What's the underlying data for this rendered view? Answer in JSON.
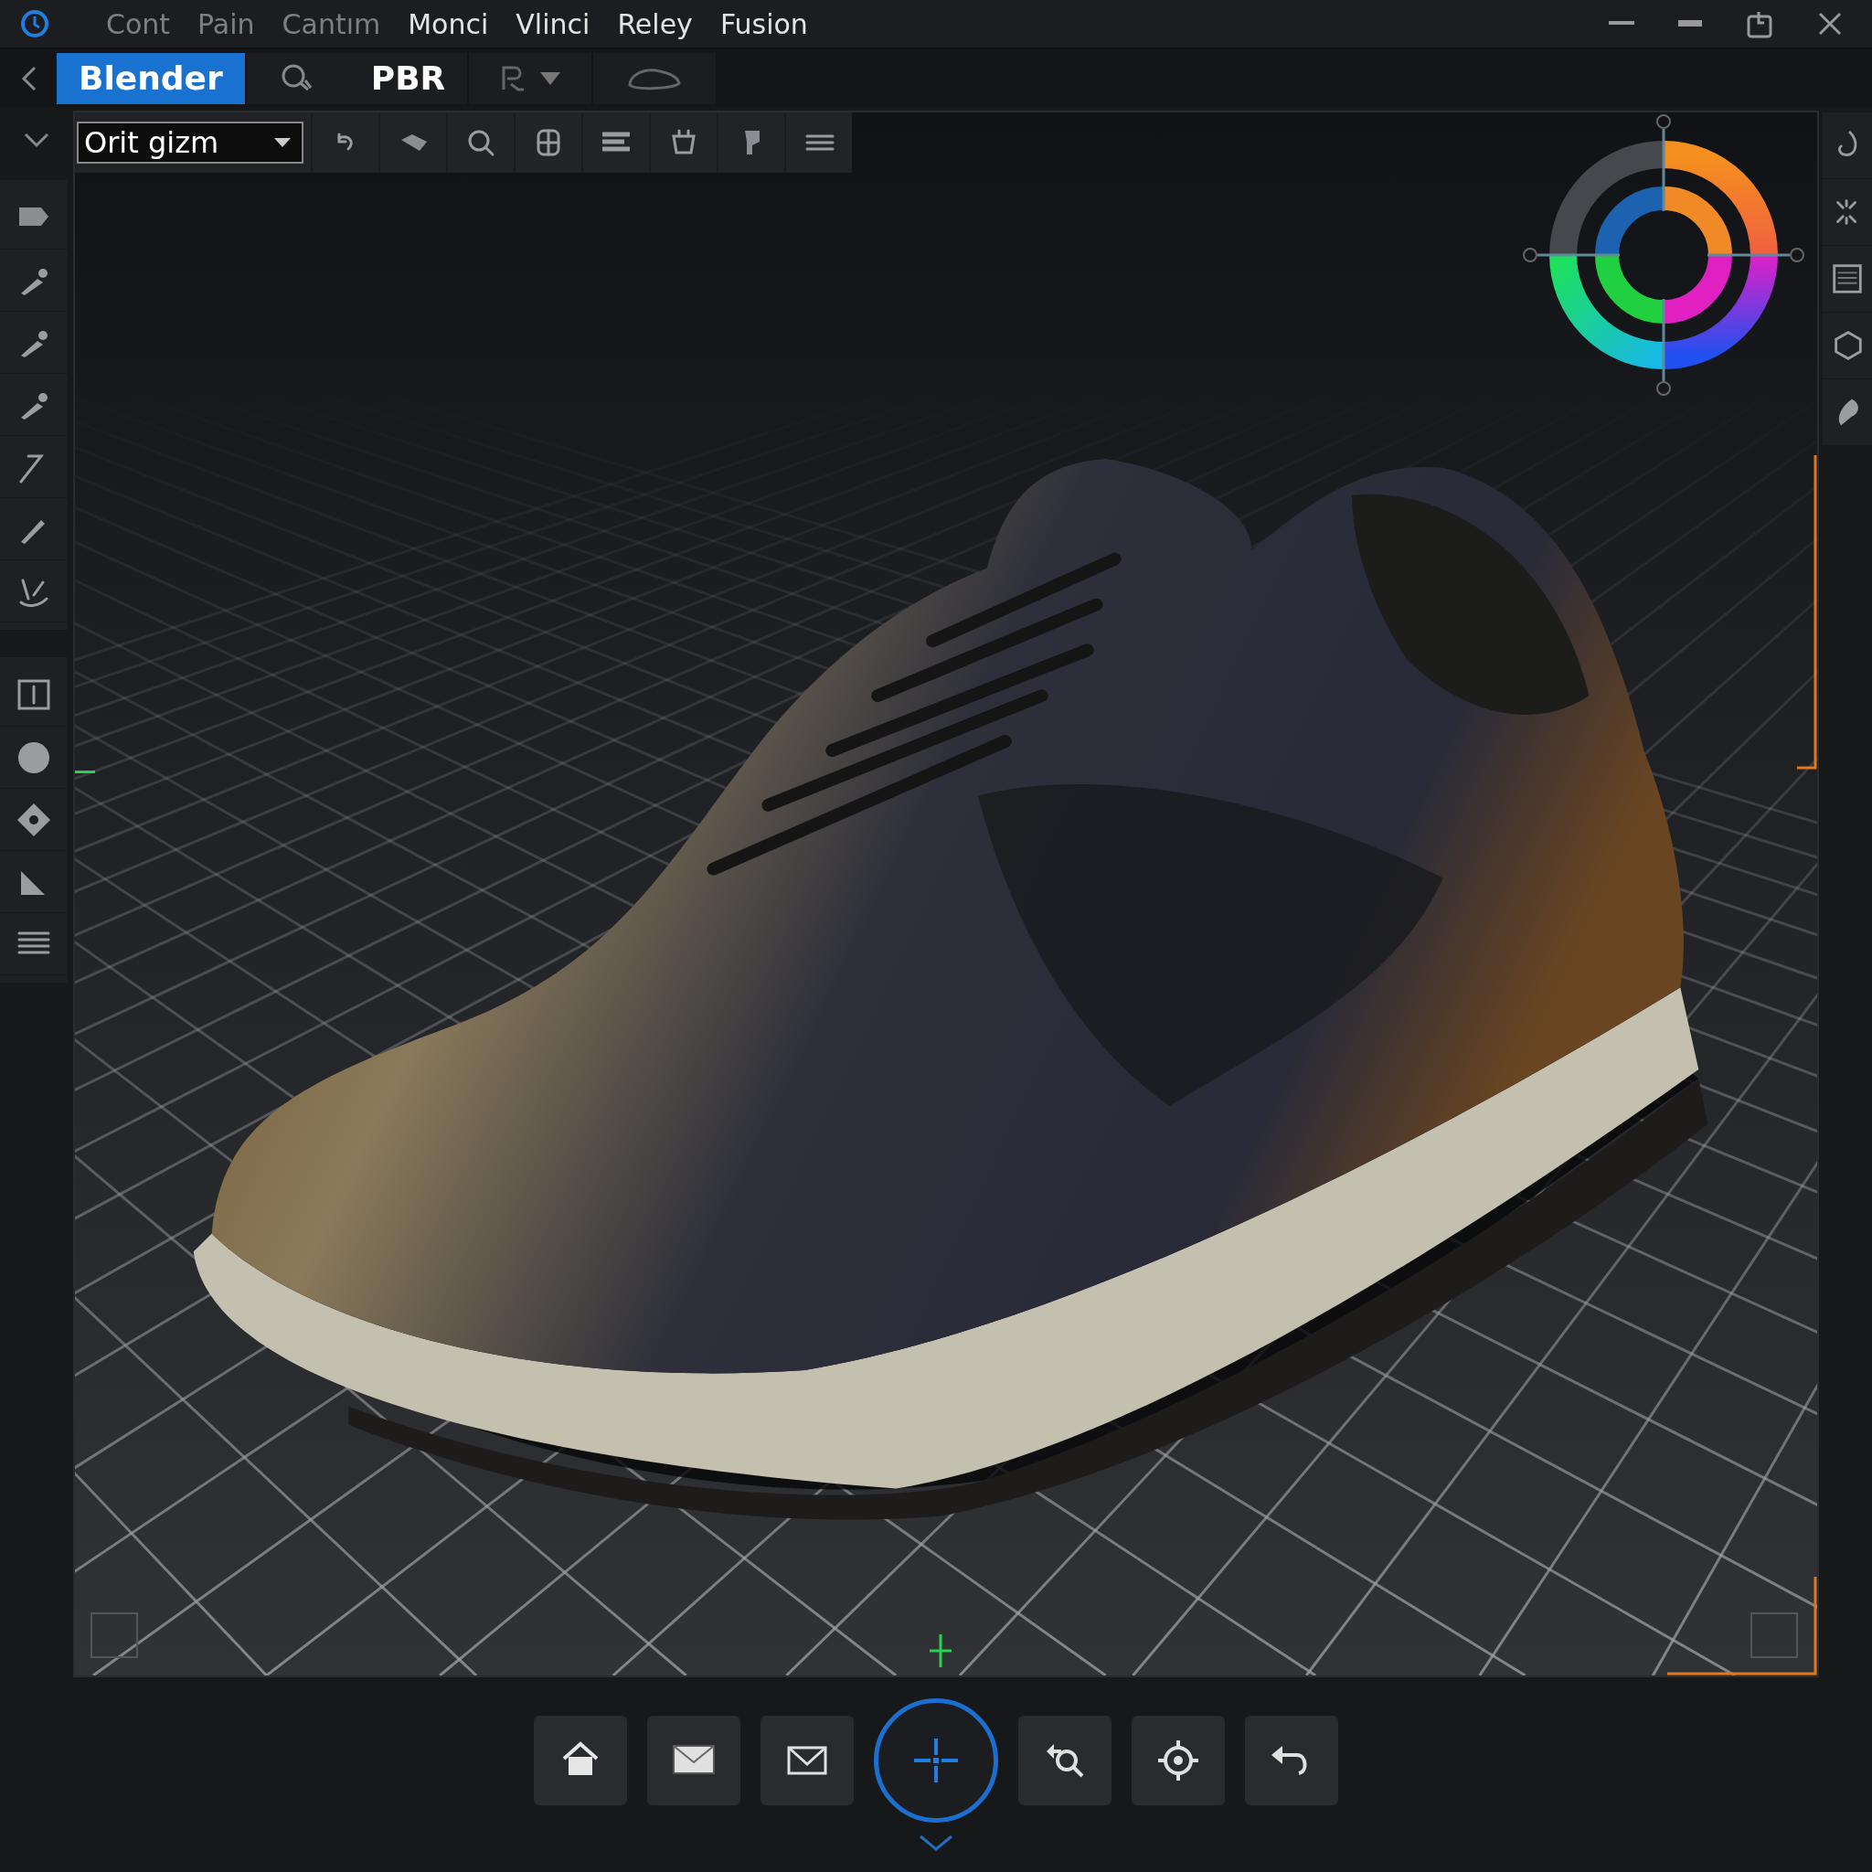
{
  "menu": [
    {
      "label": "Cont",
      "dimmed": true
    },
    {
      "label": "Pain",
      "dimmed": true
    },
    {
      "label": "Cantım",
      "dimmed": true
    },
    {
      "label": "Monci",
      "dimmed": false
    },
    {
      "label": "Vlinci",
      "dimmed": false
    },
    {
      "label": "Reley",
      "dimmed": false
    },
    {
      "label": "Fusion",
      "dimmed": false
    }
  ],
  "tabs": [
    {
      "label": "Blender",
      "selected": true
    },
    {
      "label": "PBR",
      "selected": false
    }
  ],
  "toolbar": {
    "mode_dropdown": {
      "value": "Orit gizm"
    }
  },
  "nav_tools": [
    {
      "kind": "home",
      "selected": false
    },
    {
      "kind": "mail-filled",
      "selected": false
    },
    {
      "kind": "mail-outline",
      "selected": false
    },
    {
      "kind": "move",
      "selected": true
    },
    {
      "kind": "zoom-back",
      "selected": false
    },
    {
      "kind": "target",
      "selected": false
    },
    {
      "kind": "undo",
      "selected": false
    }
  ]
}
